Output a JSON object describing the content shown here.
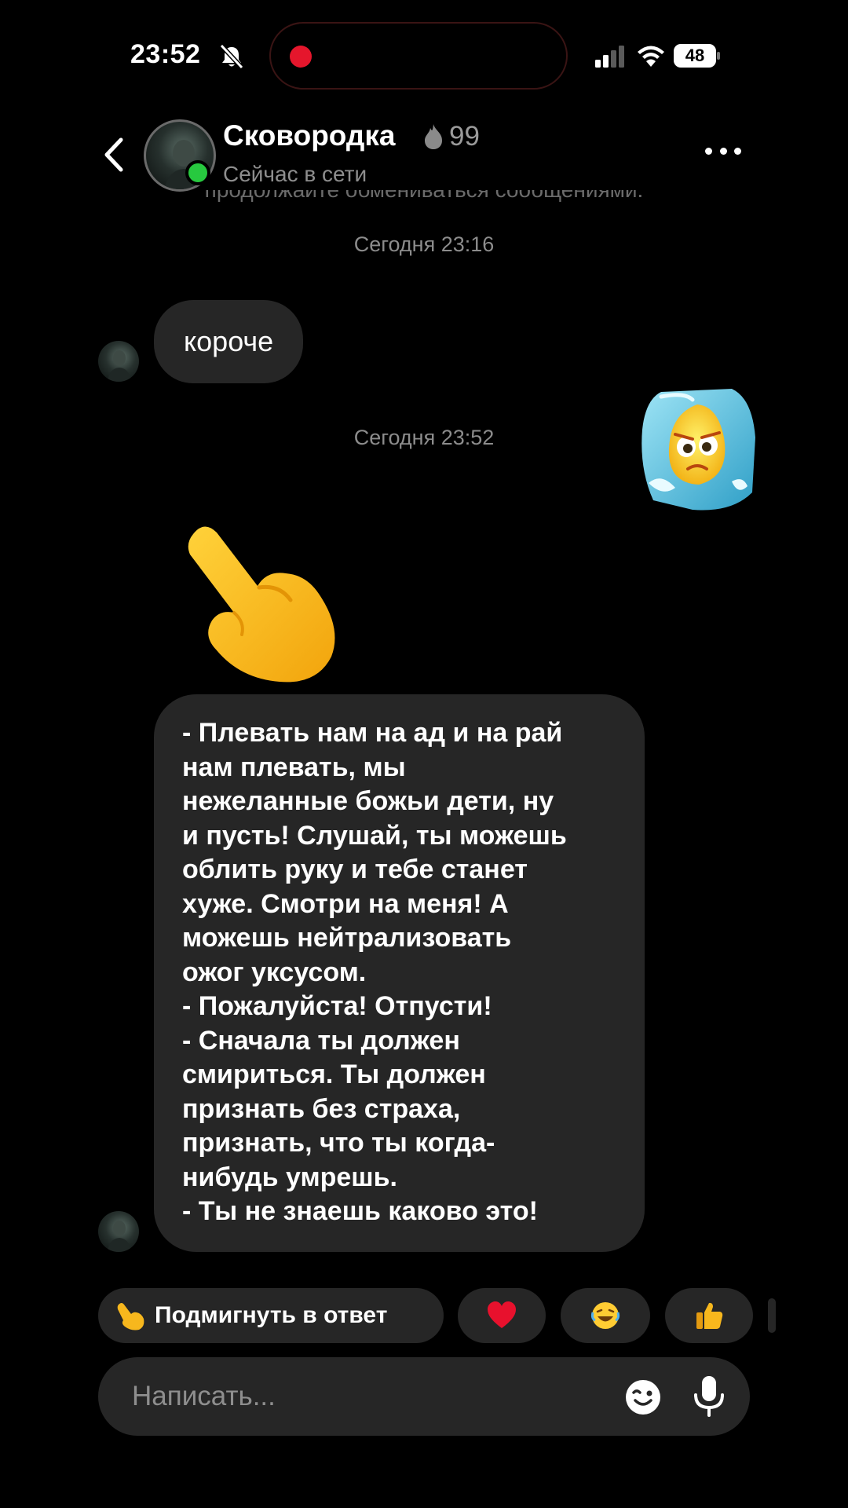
{
  "status_bar": {
    "time": "23:52",
    "battery": "48"
  },
  "header": {
    "contact_name": "Сковородка",
    "streak": "99",
    "status": "Сейчас в сети",
    "clipped_system_text": "продолжайте обмениваться сообщениями."
  },
  "messages": {
    "timestamp_1": "Сегодня 23:16",
    "short_message": "короче",
    "timestamp_2": "Сегодня 23:52",
    "long_message_lines": [
      "- Плевать нам на ад и на рай",
      "нам плевать, мы",
      "нежеланные божьи дети, ну",
      "и пусть! Слушай, ты можешь",
      "облить руку и тебе станет",
      "хуже. Смотри на меня! А",
      "можешь нейтрализовать",
      "ожог уксусом.",
      "- Пожалуйста! Отпусти!",
      "- Сначала ты должен",
      "смириться. Ты должен",
      "признать без страха,",
      "признать, что ты когда-",
      "нибудь умрешь.",
      "- Ты не знаешь каково это!"
    ]
  },
  "quick_replies": {
    "wink_label": "Подмигнуть в ответ",
    "items": [
      "heart",
      "laughing",
      "thumbs-up"
    ]
  },
  "composer": {
    "placeholder": "Написать..."
  },
  "icons": {
    "bell-muted": "bell-slash-icon",
    "back": "chevron-left-icon",
    "more": "ellipsis-icon",
    "emoji": "emoji-icon",
    "mic": "microphone-icon"
  },
  "colors": {
    "background": "#000000",
    "bubble": "#262626",
    "online": "#27c93f",
    "recording": "#e5162c",
    "muted_text": "#8c8c8c"
  }
}
